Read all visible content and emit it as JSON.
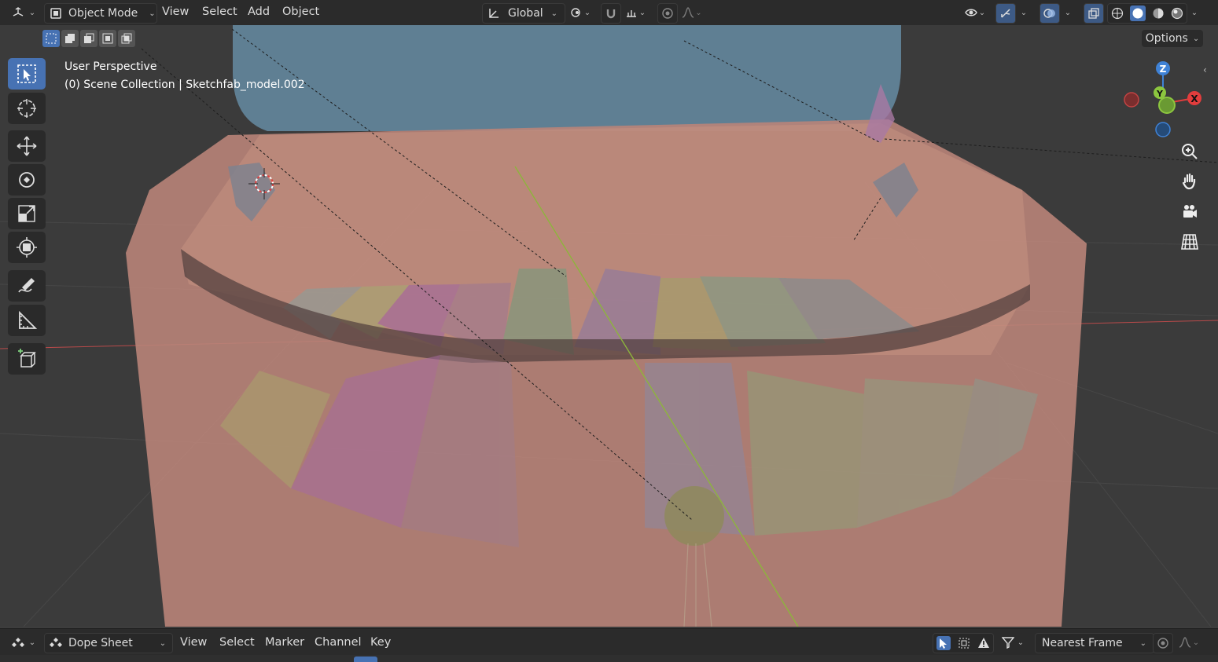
{
  "header": {
    "mode_label": "Object Mode",
    "menus": [
      "View",
      "Select",
      "Add",
      "Object"
    ],
    "transform_orientation": "Global",
    "options_label": "Options"
  },
  "viewport": {
    "perspective_label": "User Perspective",
    "collection_label": "(0) Scene Collection | Sketchfab_model.002"
  },
  "gizmo": {
    "z_label": "Z",
    "y_label": "Y",
    "x_label": "X"
  },
  "dopesheet": {
    "editor_label": "Dope Sheet",
    "menus": [
      "View",
      "Select",
      "Marker",
      "Channel",
      "Key"
    ],
    "snap_label": "Nearest Frame"
  },
  "colors": {
    "accent": "#4772b3",
    "x_axis": "#e23d3d",
    "y_axis": "#8cc63f",
    "z_axis": "#3f82d6",
    "header_bg": "#2b2b2b",
    "viewport_bg": "#3b3b3b"
  }
}
